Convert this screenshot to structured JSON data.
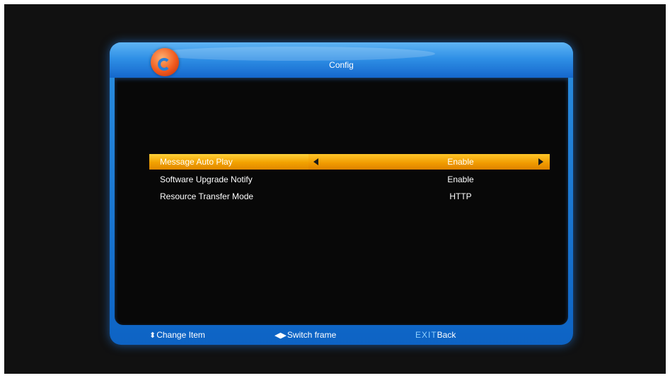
{
  "window": {
    "title": "Config"
  },
  "settings": [
    {
      "label": "Message Auto Play",
      "value": "Enable",
      "selected": true
    },
    {
      "label": "Software Upgrade Notify",
      "value": "Enable",
      "selected": false
    },
    {
      "label": "Resource Transfer Mode",
      "value": "HTTP",
      "selected": false
    }
  ],
  "footer": {
    "change_item": "Change Item",
    "switch_frame": "Switch frame",
    "exit_key": "EXIT",
    "back": "Back"
  },
  "icons": {
    "change_item": "up-down-arrows-icon",
    "switch_frame": "left-right-arrows-icon"
  },
  "colors": {
    "accent_blue": "#1f7ad8",
    "highlight_orange": "#f2a100",
    "background": "#111111"
  }
}
